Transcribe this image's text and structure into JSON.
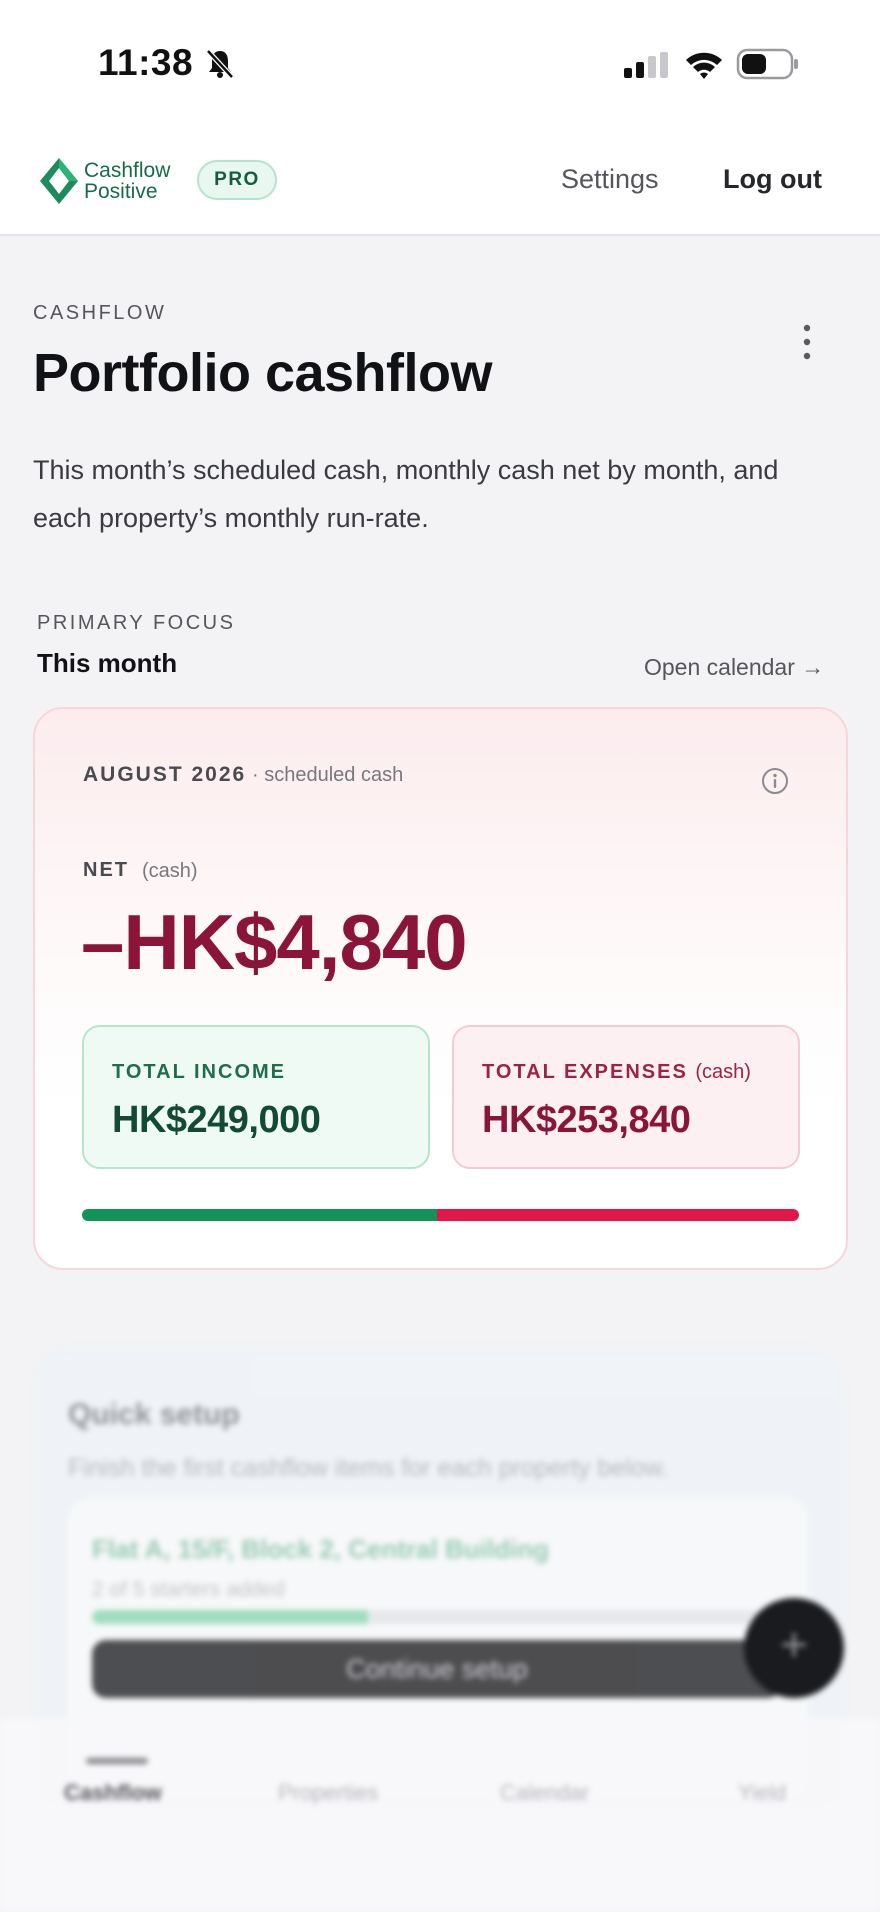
{
  "status_bar": {
    "time": "11:38"
  },
  "header": {
    "logo_line1": "Cashflow",
    "logo_line2": "Positive",
    "badge": "PRO",
    "settings": "Settings",
    "logout": "Log out"
  },
  "page": {
    "eyebrow": "CASHFLOW",
    "title": "Portfolio cashflow",
    "description": "This month’s scheduled cash, monthly cash net by month, and each property’s monthly run-rate."
  },
  "focus": {
    "eyebrow": "PRIMARY FOCUS",
    "title": "This month",
    "link": "Open calendar →"
  },
  "cash_card": {
    "month": "AUGUST 2026",
    "month_note": "· scheduled cash",
    "net_label": "NET",
    "net_note": "(cash)",
    "net_value": "–HK$4,840",
    "income_label": "TOTAL INCOME",
    "income_value": "HK$249,000",
    "expense_label": "TOTAL EXPENSES",
    "expense_note": "(cash)",
    "expense_value": "HK$253,840",
    "income_share": 0.495,
    "colors": {
      "income": "#12935a",
      "expense": "#e3164a",
      "net_negative": "#8a1538"
    }
  },
  "quick_setup": {
    "title": "Quick setup",
    "description": "Finish the first cashflow items for each property below.",
    "property_name": "Flat A, 15/F, Block 2, Central Building",
    "progress_text": "2 of 5 starters added",
    "progress": 0.4,
    "button": "Continue setup"
  },
  "fab": {
    "icon": "plus-icon",
    "label": "+"
  },
  "tabs": [
    {
      "label": "Cashflow",
      "active": true
    },
    {
      "label": "Properties",
      "active": false
    },
    {
      "label": "Calendar",
      "active": false
    },
    {
      "label": "Yield",
      "active": false
    }
  ]
}
